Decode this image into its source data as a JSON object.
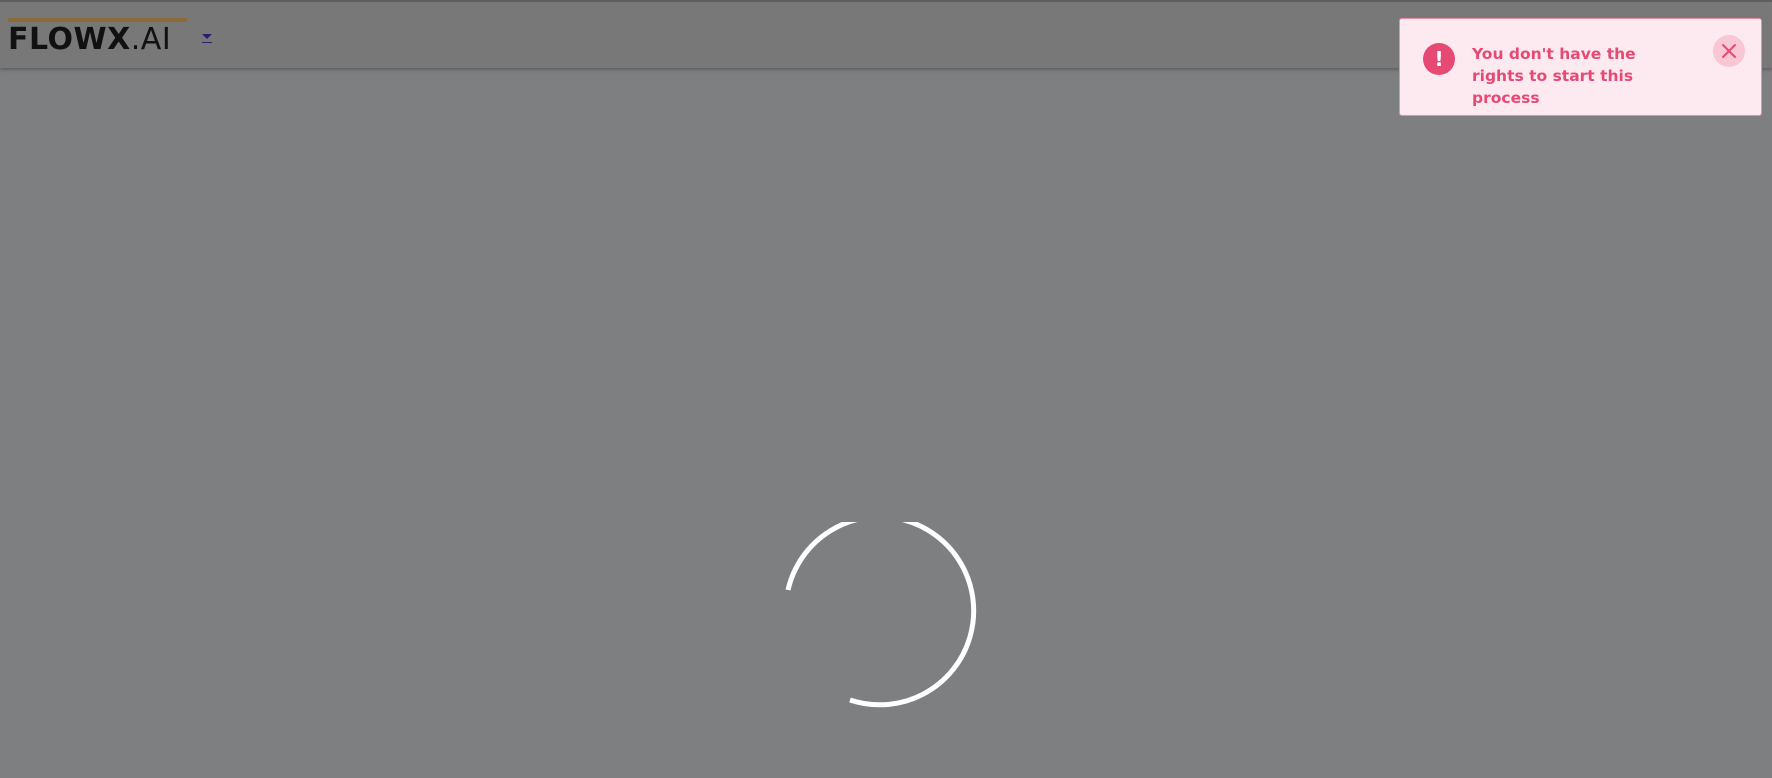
{
  "header": {
    "logo_strong": "FLOWX",
    "logo_light": ".AI",
    "logo_bar_color": "#8a6a38",
    "dropdown_icon": "caret-down-icon"
  },
  "toast": {
    "type": "error",
    "icon": "exclamation-icon",
    "icon_glyph": "!",
    "message": "You don't have the rights to start this process",
    "close_icon": "close-icon",
    "accent_color": "#e64a74",
    "background_color": "#fdeaf0"
  },
  "loading": {
    "icon": "spinner-icon"
  }
}
